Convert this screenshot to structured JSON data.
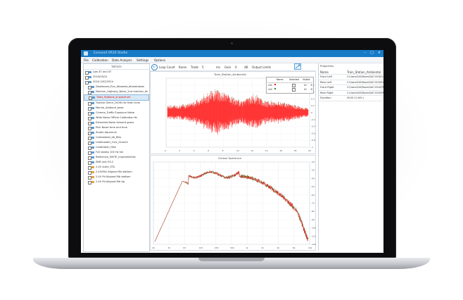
{
  "window": {
    "title": "Exsound VR30 Studio",
    "controls": [
      "–",
      "□",
      "×"
    ]
  },
  "menu": [
    "File",
    "Calibration",
    "Data Analysis",
    "Settings",
    "Options"
  ],
  "tree": {
    "header": "Vehicle",
    "items": [
      "Low 4T and 4T",
      "2024/05/31",
      "2024-2/02/2024",
      "Dashboard_Run_Ibbowed_bbreakdown",
      "Medium_Highway_Noise_2nd reaction_bk",
      "Trials_Stations_Is spectrum",
      "Turbine Gtech_100Hz 6s fresh tune",
      "Marine_Ambient_base",
      "Cinema_Traffic Exposure Noise",
      "Wide Noise Offline Calibration 6s",
      "Extended Noise forward gears",
      "Pink Noise time and time",
      "Studio Aquarium",
      "Carbrooked_db_files",
      "Underwater_Calc_Ground",
      "Calibration_files",
      "Full sweep 100 Hz full",
      "Reference_INVTE_imprestivities",
      "SNR and OS-2",
      "2.4V scale_STA",
      "2.4V/Fills Aligned Rib bottom",
      "2.4V Pd Aligned Rib bottom",
      "2.4V Pd Aligned Rib tip"
    ]
  },
  "toolbar": {
    "loop_label": "Loop Count",
    "loop_value": "Karen",
    "trade_label": "Trade",
    "trade_value": "5",
    "ms_label": "ms",
    "gain_label": "Gain",
    "gain_value": "0",
    "db_label": "dB",
    "output_label": "Output Limits"
  },
  "time_plot": {
    "title": "Train_Station_Ambiental",
    "legend_headers": [
      "Name",
      "Selected",
      "Visible"
    ],
    "legend_rows": [
      "ch1",
      "ch2"
    ],
    "y_ticks": [
      "1",
      "0.8",
      "0.6",
      "0.4",
      "0.2",
      "0",
      "-0.2",
      "-0.4",
      "-0.6",
      "-0.8",
      "-1"
    ],
    "x_ticks": [
      "0",
      "2",
      "4",
      "6",
      "8",
      "10",
      "12",
      "14",
      "16",
      "18",
      "20"
    ],
    "colors": {
      "ch1": "#ff1a1a",
      "ch2": "#2e8b2e"
    }
  },
  "spectrum_plot": {
    "title": "Octave Spectrum",
    "y_ticks": [
      "-20",
      "-30",
      "-40",
      "-50",
      "-60",
      "-70",
      "-80",
      "-90",
      "-100",
      "-110",
      "-120"
    ],
    "x_ticks": [
      "16",
      "32",
      "63",
      "125",
      "250",
      "500",
      "1k",
      "2k",
      "4k",
      "8k",
      "16k"
    ]
  },
  "properties": {
    "header": "Properties",
    "rows": [
      {
        "key": "Name",
        "value": "Train_Station_Ambiental"
      },
      {
        "key": "Front Left",
        "value": "C:\\Users\\SAS\\Room\\SAS 2024\\FL.wav"
      },
      {
        "key": "Rear Left",
        "value": "C:\\Users\\SAS\\Room\\SAS 2024\\RL.wav"
      },
      {
        "key": "Front Right",
        "value": "C:\\Users\\SAS\\Room\\SAS 2024\\FR.wav"
      },
      {
        "key": "Rear Right",
        "value": "C:\\Users\\SAS\\Room\\SAS 2024\\RR.wav"
      },
      {
        "key": "Duration",
        "value": "00:00:11.945 s"
      }
    ]
  }
}
